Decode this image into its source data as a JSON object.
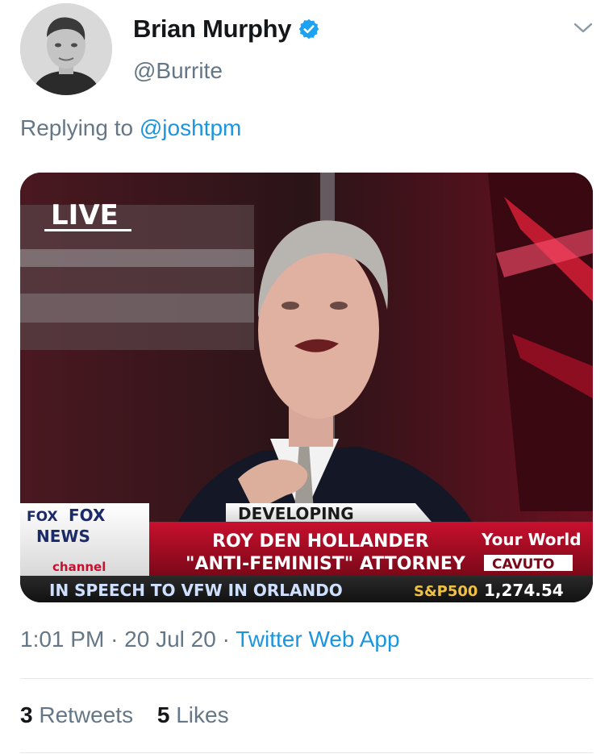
{
  "tweet": {
    "author": {
      "display_name": "Brian Murphy",
      "handle": "@Burrite",
      "verified": true,
      "avatar_icon": "profile-photo"
    },
    "reply": {
      "prefix": "Replying to",
      "mention": "@joshtpm"
    },
    "media": {
      "live_label": "LIVE",
      "network_logo_left": "FOX NEWS channel",
      "network_logo_top": "FOX",
      "network_logo_mid": "NEWS",
      "network_logo_sub": "channel",
      "headline_tag": "DEVELOPING",
      "name_line": "ROY DEN HOLLANDER",
      "title_line": "\"ANTI-FEMINIST\" ATTORNEY",
      "ticker_text": "IN SPEECH TO VFW IN ORLANDO",
      "ticker_index": "S&P500",
      "ticker_value": "1,274.54",
      "show_line1": "Your World",
      "show_line2": "CAVUTO"
    },
    "time": "1:01 PM",
    "separator": "·",
    "date": "20 Jul 20",
    "source": "Twitter Web App",
    "retweets": {
      "count": "3",
      "label": "Retweets"
    },
    "likes": {
      "count": "5",
      "label": "Likes"
    }
  },
  "colors": {
    "link_blue": "#1b95e0",
    "muted_gray": "#657786",
    "verified_blue": "#1da1f2",
    "divider": "#e1e8ed"
  }
}
